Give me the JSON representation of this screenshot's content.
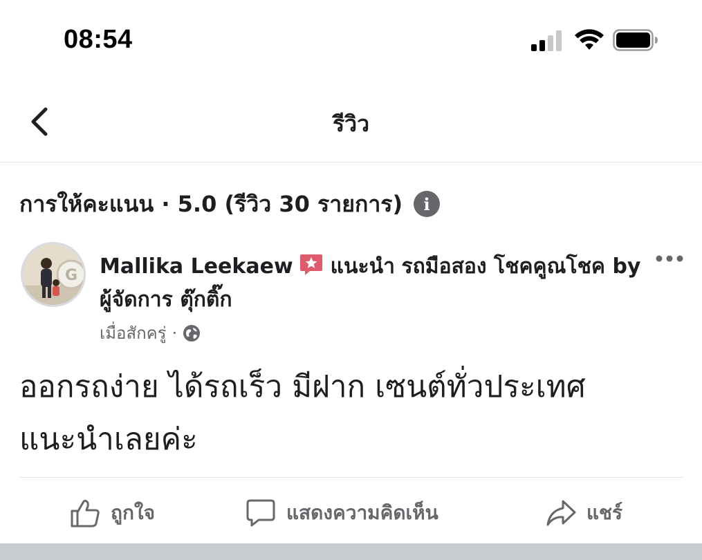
{
  "status_bar": {
    "time": "08:54",
    "icons": [
      "cellular-signal-icon",
      "wifi-icon",
      "battery-icon"
    ]
  },
  "nav": {
    "title": "รีวิว",
    "back_icon": "chevron-left-icon"
  },
  "rating": {
    "summary": "การให้คะแนน · 5.0 (รีวิว 30 รายการ)",
    "info_icon": "info-icon"
  },
  "post": {
    "author": "Mallika Leekaew",
    "recommend_label": "แนะนำ",
    "page_name": "รถมือสอง โชคคูณโชค by ผู้จัดการ ตุ๊กติ๊ก",
    "timestamp": "เมื่อสักครู่",
    "separator": "·",
    "audience_icon": "globe-icon",
    "body": "ออกรถง่าย ได้รถเร็ว มีฝาก เซนต์ทั่วประเทศแนะนำเลยค่ะ"
  },
  "actions": {
    "like_label": "ถูกใจ",
    "comment_label": "แสดงความคิดเห็น",
    "share_label": "แชร์"
  },
  "colors": {
    "text_primary": "#1c1e21",
    "text_secondary": "#65676b",
    "recommend_badge": "#e05a6e",
    "divider": "#e4e6eb",
    "bottom_band": "#c9ccd1"
  }
}
